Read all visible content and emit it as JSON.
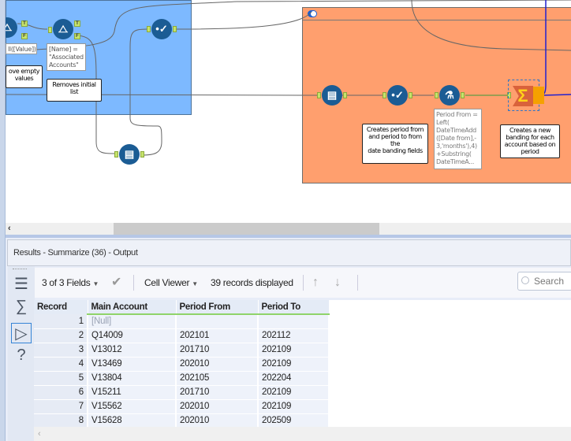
{
  "canvas": {
    "blue_container": {
      "expression_partial": "ll([Value])",
      "filter_expression": "[Name] =\n\"Associated\nAccounts\"",
      "note_remove_empty": "ove empty\nvalues",
      "note_removes_initial": "Removes initial\nlist",
      "filter_true_label": "T",
      "filter_false_label": "F"
    },
    "orange_container": {
      "note_creates_period": "Creates period from\nand period to from the\ndate banding fields",
      "formula_expression": "Period From =\nLeft(\nDateTimeAdd\n([Date from],-\n3,'months'),4)\n+Substring(\nDateTimeA...",
      "note_new_banding": "Creates a new\nbanding for each\naccount based on\nperiod"
    },
    "icons": {
      "filter": "filter-icon",
      "select": "select-icon",
      "multirow": "multi-row-formula-icon",
      "formula": "formula-icon",
      "summarize": "summarize-icon"
    },
    "colors": {
      "blue_container": "#7db9ff",
      "orange_container": "#ff9f6e",
      "tool_blue": "#1b5c94",
      "summarize": "#d9623b"
    }
  },
  "results": {
    "title": "Results - Summarize (36) - Output",
    "fields_selector": "3 of 3 Fields",
    "cell_viewer": "Cell Viewer",
    "records_displayed": "39 records displayed",
    "search_placeholder": "Search",
    "columns": [
      "Record",
      "Main Account",
      "Period From",
      "Period To"
    ],
    "rows": [
      {
        "record": "1",
        "main_account": "[Null]",
        "period_from": "",
        "period_to": ""
      },
      {
        "record": "2",
        "main_account": "Q14009",
        "period_from": "202101",
        "period_to": "202112"
      },
      {
        "record": "3",
        "main_account": "V13012",
        "period_from": "201710",
        "period_to": "202109"
      },
      {
        "record": "4",
        "main_account": "V13469",
        "period_from": "202010",
        "period_to": "202109"
      },
      {
        "record": "5",
        "main_account": "V13804",
        "period_from": "202105",
        "period_to": "202204"
      },
      {
        "record": "6",
        "main_account": "V15211",
        "period_from": "201710",
        "period_to": "202109"
      },
      {
        "record": "7",
        "main_account": "V15562",
        "period_from": "202010",
        "period_to": "202109"
      },
      {
        "record": "8",
        "main_account": "V15628",
        "period_from": "202010",
        "period_to": "202509"
      }
    ]
  }
}
